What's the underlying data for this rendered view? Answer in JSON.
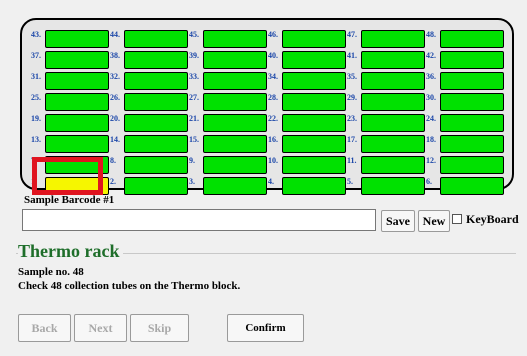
{
  "rack_grid": {
    "slots": [
      {
        "num": "43.",
        "color": "green"
      },
      {
        "num": "44.",
        "color": "green"
      },
      {
        "num": "45.",
        "color": "green"
      },
      {
        "num": "46.",
        "color": "green"
      },
      {
        "num": "47.",
        "color": "green"
      },
      {
        "num": "48.",
        "color": "green"
      },
      {
        "num": "37.",
        "color": "green"
      },
      {
        "num": "38.",
        "color": "green"
      },
      {
        "num": "39.",
        "color": "green"
      },
      {
        "num": "40.",
        "color": "green"
      },
      {
        "num": "41.",
        "color": "green"
      },
      {
        "num": "42.",
        "color": "green"
      },
      {
        "num": "31.",
        "color": "green"
      },
      {
        "num": "32.",
        "color": "green"
      },
      {
        "num": "33.",
        "color": "green"
      },
      {
        "num": "34.",
        "color": "green"
      },
      {
        "num": "35.",
        "color": "green"
      },
      {
        "num": "36.",
        "color": "green"
      },
      {
        "num": "25.",
        "color": "green"
      },
      {
        "num": "26.",
        "color": "green"
      },
      {
        "num": "27.",
        "color": "green"
      },
      {
        "num": "28.",
        "color": "green"
      },
      {
        "num": "29.",
        "color": "green"
      },
      {
        "num": "30.",
        "color": "green"
      },
      {
        "num": "19.",
        "color": "green"
      },
      {
        "num": "20.",
        "color": "green"
      },
      {
        "num": "21.",
        "color": "green"
      },
      {
        "num": "22.",
        "color": "green"
      },
      {
        "num": "23.",
        "color": "green"
      },
      {
        "num": "24.",
        "color": "green"
      },
      {
        "num": "13.",
        "color": "green"
      },
      {
        "num": "14.",
        "color": "green"
      },
      {
        "num": "15.",
        "color": "green"
      },
      {
        "num": "16.",
        "color": "green"
      },
      {
        "num": "17.",
        "color": "green"
      },
      {
        "num": "18.",
        "color": "green"
      },
      {
        "num": "7.",
        "color": "green"
      },
      {
        "num": "8.",
        "color": "green"
      },
      {
        "num": "9.",
        "color": "green"
      },
      {
        "num": "10.",
        "color": "green"
      },
      {
        "num": "11.",
        "color": "green"
      },
      {
        "num": "12.",
        "color": "green"
      },
      {
        "num": "1.",
        "color": "yellow"
      },
      {
        "num": "2.",
        "color": "green"
      },
      {
        "num": "3.",
        "color": "green"
      },
      {
        "num": "4.",
        "color": "green"
      },
      {
        "num": "5.",
        "color": "green"
      },
      {
        "num": "6.",
        "color": "green"
      }
    ]
  },
  "colors": {
    "tube_green": "#00e100",
    "tube_yellow": "#f6f600",
    "highlight": "#e0141f",
    "title_green": "#1e6e2a"
  },
  "barcode": {
    "label": "Sample Barcode #1",
    "input_value": "",
    "save_label": "Save",
    "new_label": "New",
    "keyboard_label": "KeyBoard",
    "keyboard_checked": false
  },
  "section": {
    "title": "Thermo rack",
    "sample_no": "Sample no. 48",
    "instruction": "Check 48 collection tubes on the Thermo block."
  },
  "buttons": {
    "back_label": "Back",
    "next_label": "Next",
    "skip_label": "Skip",
    "confirm_label": "Confirm"
  }
}
